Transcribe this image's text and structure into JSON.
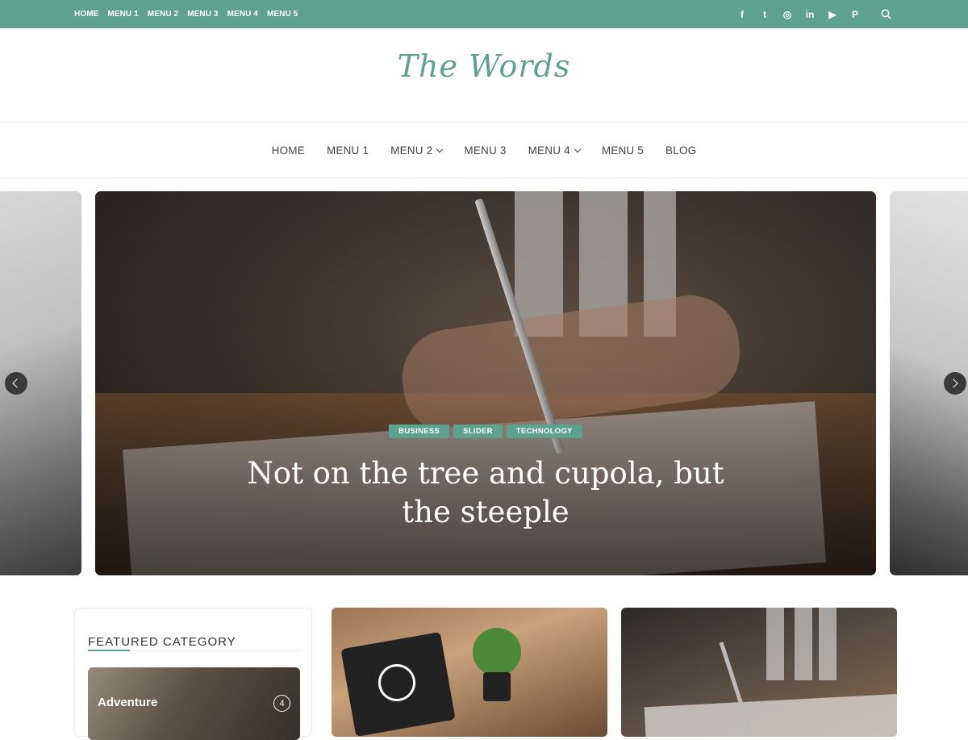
{
  "topbar": {
    "menu": [
      "HOME",
      "MENU 1",
      "MENU 2",
      "MENU 3",
      "MENU 4",
      "MENU 5"
    ],
    "social_icons": [
      "facebook-icon",
      "twitter-icon",
      "instagram-icon",
      "linkedin-icon",
      "youtube-icon",
      "pinterest-icon"
    ],
    "social_glyphs": [
      "f",
      "t",
      "◎",
      "in",
      "▶",
      "P"
    ],
    "search_glyph": "⌕"
  },
  "site": {
    "logo": "The Words"
  },
  "mainnav": {
    "items": [
      {
        "label": "HOME",
        "has_dropdown": false
      },
      {
        "label": "MENU 1",
        "has_dropdown": false
      },
      {
        "label": "MENU 2",
        "has_dropdown": true
      },
      {
        "label": "MENU 3",
        "has_dropdown": false
      },
      {
        "label": "MENU 4",
        "has_dropdown": true
      },
      {
        "label": "MENU 5",
        "has_dropdown": false
      },
      {
        "label": "BLOG",
        "has_dropdown": false
      }
    ]
  },
  "slider": {
    "tags": [
      "BUSINESS",
      "SLIDER",
      "TECHNOLOGY"
    ],
    "title_line1": "Not on the tree and cupola, but",
    "title_line2": "the steeple"
  },
  "featured": {
    "heading": "FEATURED CATEGORY",
    "category_name": "Adventure",
    "category_count": "4"
  },
  "colors": {
    "accent": "#5ea18e",
    "topbar_bg": "#5ea18e"
  }
}
